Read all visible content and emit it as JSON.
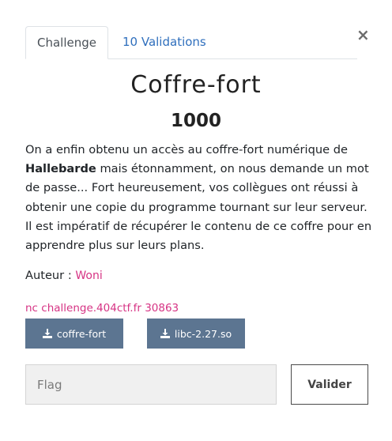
{
  "modal": {
    "close_label": "×"
  },
  "tabs": [
    {
      "label": "Challenge",
      "active": true
    },
    {
      "label": "10 Validations",
      "active": false
    }
  ],
  "challenge": {
    "name": "Coffre-fort",
    "points": "1000",
    "description": {
      "part1": "On a enfin obtenu un accès au coffre-fort numérique de ",
      "bold": "Hallebarde",
      "part2": " mais étonnamment, on nous demande un mot de passe... Fort heureusement, vos collègues ont réussi à obtenir une copie du programme tournant sur leur serveur. Il est impératif de récupérer le contenu de ce coffre pour en apprendre plus sur leurs plans."
    },
    "author_label": "Auteur : ",
    "author_name": "Woni",
    "connection": "nc challenge.404ctf.fr 30863"
  },
  "files": [
    {
      "label": "coffre-fort",
      "icon": "download-icon"
    },
    {
      "label": "libc-2.27.so",
      "icon": "download-icon"
    }
  ],
  "submission": {
    "placeholder": "Flag",
    "value": "",
    "button_label": "Valider"
  },
  "colors": {
    "accent_link": "#2f6fbd",
    "author": "#d63384",
    "file_button": "#5c7591"
  }
}
